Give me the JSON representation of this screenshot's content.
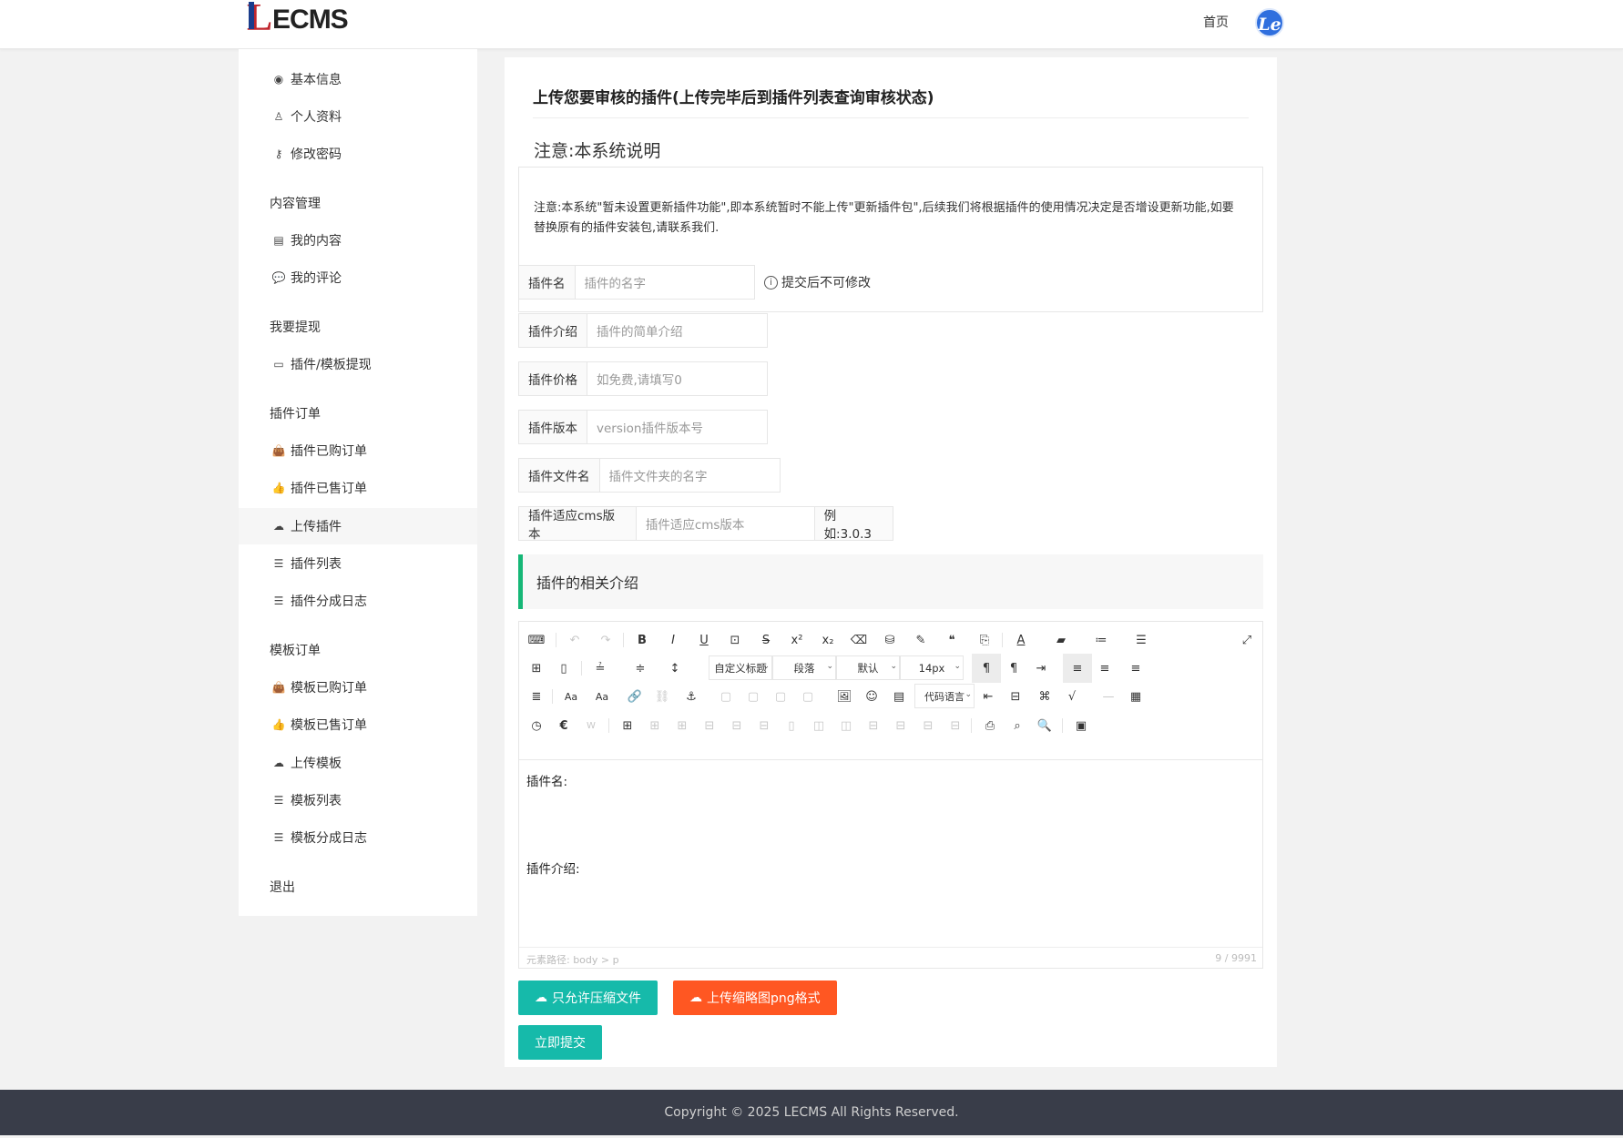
{
  "header": {
    "logo_first": "L",
    "logo_rest": "ECMS",
    "home_label": "首页",
    "avatar_text": "Le"
  },
  "sidebar": {
    "items": [
      {
        "label": "基本信息",
        "icon": "user-circle-icon"
      },
      {
        "label": "个人资料",
        "icon": "user-icon"
      },
      {
        "label": "修改密码",
        "icon": "key-icon"
      },
      {
        "label": "内容管理",
        "heading": true
      },
      {
        "label": "我的内容",
        "icon": "newspaper-icon"
      },
      {
        "label": "我的评论",
        "icon": "comments-icon"
      },
      {
        "label": "我要提现",
        "heading": true
      },
      {
        "label": "插件/模板提现",
        "icon": "credit-card-icon"
      },
      {
        "label": "插件订单",
        "heading": true
      },
      {
        "label": "插件已购订单",
        "icon": "shopping-bag-icon"
      },
      {
        "label": "插件已售订单",
        "icon": "thumbs-up-icon"
      },
      {
        "label": "上传插件",
        "icon": "cloud-upload-icon",
        "active": true
      },
      {
        "label": "插件列表",
        "icon": "list-icon"
      },
      {
        "label": "插件分成日志",
        "icon": "list-icon"
      },
      {
        "label": "模板订单",
        "heading": true
      },
      {
        "label": "模板已购订单",
        "icon": "shopping-bag-icon"
      },
      {
        "label": "模板已售订单",
        "icon": "thumbs-up-icon"
      },
      {
        "label": "上传模板",
        "icon": "cloud-upload-icon"
      },
      {
        "label": "模板列表",
        "icon": "list-icon"
      },
      {
        "label": "模板分成日志",
        "icon": "list-icon"
      },
      {
        "label": "退出",
        "heading": true
      }
    ]
  },
  "main": {
    "title": "上传您要审核的插件(上传完毕后到插件列表查询审核状态)",
    "notice": {
      "legend": "注意:本系统说明",
      "text": "注意:本系统\"暂未设置更新插件功能\",即本系统暂时不能上传\"更新插件包\",后续我们将根据插件的使用情况决定是否增设更新功能,如要替换原有的插件安装包,请联系我们."
    },
    "fields": {
      "name": {
        "label": "插件名",
        "placeholder": "插件的名字",
        "hint": "提交后不可修改"
      },
      "intro": {
        "label": "插件介绍",
        "placeholder": "插件的简单介绍"
      },
      "price": {
        "label": "插件价格",
        "placeholder": "如免费,请填写0"
      },
      "version": {
        "label": "插件版本",
        "placeholder": "version插件版本号"
      },
      "folder": {
        "label": "插件文件名",
        "placeholder": "插件文件夹的名字"
      },
      "cms": {
        "label": "插件适应cms版本",
        "placeholder": "插件适应cms版本",
        "suffix": "例如:3.0.3"
      }
    },
    "section_title": "插件的相关介绍",
    "editor": {
      "selects": {
        "heading": "自定义标题",
        "paragraph": "段落",
        "font": "默认",
        "size": "14px",
        "code": "代码语言"
      },
      "content_line1": "插件名:",
      "content_line2": "插件介绍:",
      "path": "元素路径: body > p",
      "count": "9 / 9991"
    },
    "buttons": {
      "zip": "只允许压缩文件",
      "thumb": "上传缩略图png格式",
      "submit": "立即提交"
    }
  },
  "footer": {
    "copyright": "Copyright © 2025 LECMS All Rights Reserved."
  },
  "colors": {
    "teal": "#16baaa",
    "orange": "#ff5722",
    "green_border": "#16b777",
    "footer_bg": "#393d49",
    "avatar": "#2f6fde"
  }
}
